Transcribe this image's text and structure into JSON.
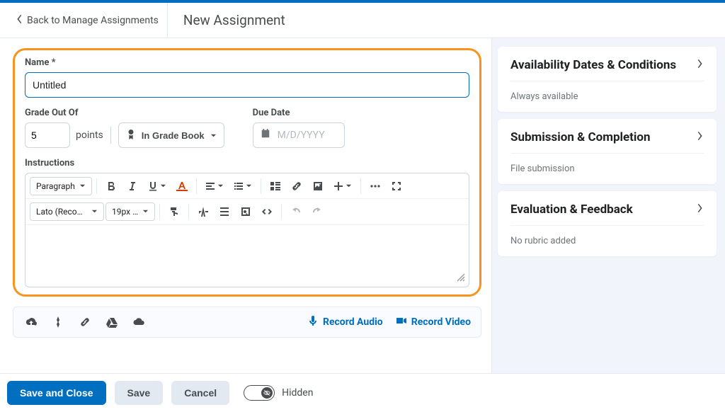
{
  "header": {
    "back_label": "Back to Manage Assignments",
    "page_title": "New Assignment"
  },
  "form": {
    "name_label": "Name *",
    "name_value": "Untitled",
    "grade_label": "Grade Out Of",
    "grade_value": "5",
    "points_label": "points",
    "gradebook_label": "In Grade Book",
    "due_label": "Due Date",
    "due_placeholder": "M/D/YYYY",
    "instructions_label": "Instructions"
  },
  "editor": {
    "block_format": "Paragraph",
    "font_family": "Lato (Recom…",
    "font_size": "19px …"
  },
  "media": {
    "record_audio": "Record Audio",
    "record_video": "Record Video"
  },
  "panels": {
    "availability": {
      "title": "Availability Dates & Conditions",
      "sub": "Always available"
    },
    "submission": {
      "title": "Submission & Completion",
      "sub": "File submission"
    },
    "evaluation": {
      "title": "Evaluation & Feedback",
      "sub": "No rubric added"
    }
  },
  "footer": {
    "save_and_close": "Save and Close",
    "save": "Save",
    "cancel": "Cancel",
    "visibility_label": "Hidden"
  }
}
